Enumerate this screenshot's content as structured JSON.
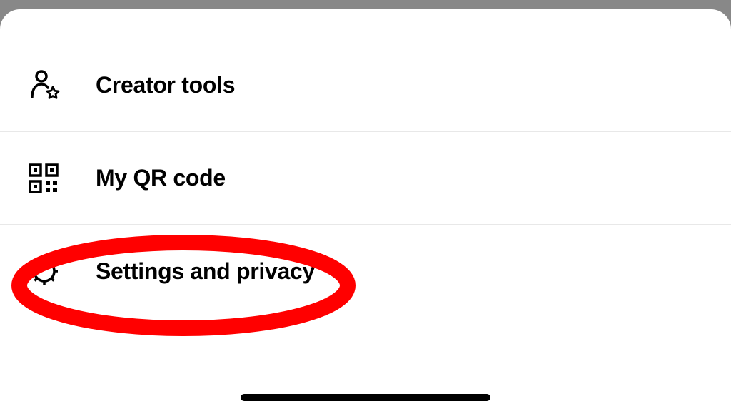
{
  "menu": {
    "items": [
      {
        "label": "Creator tools",
        "icon": "person-star-icon"
      },
      {
        "label": "My QR code",
        "icon": "qr-code-icon"
      },
      {
        "label": "Settings and privacy",
        "icon": "gear-icon"
      }
    ]
  }
}
